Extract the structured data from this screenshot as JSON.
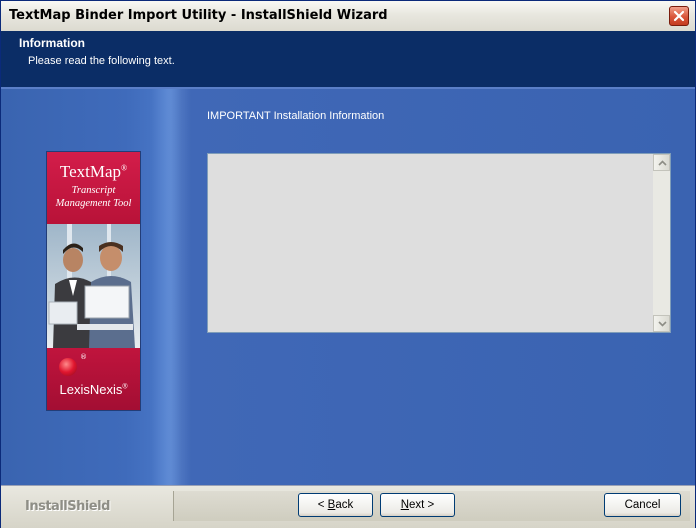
{
  "window": {
    "title": "TextMap Binder Import Utility - InstallShield Wizard"
  },
  "header": {
    "title": "Information",
    "subtitle": "Please read the following text."
  },
  "main": {
    "section_label": "IMPORTANT Installation Information",
    "text_content": ""
  },
  "banner": {
    "brand": "TextMap",
    "brand_mark": "®",
    "tagline_line1": "Transcript",
    "tagline_line2": "Management Tool",
    "company": "LexisNexis",
    "company_mark": "®",
    "logo_mark": "®"
  },
  "footer": {
    "brand": "InstallShield",
    "back_prefix": "< ",
    "back_key": "B",
    "back_rest": "ack",
    "next_key": "N",
    "next_rest": "ext >",
    "cancel_label": "Cancel"
  },
  "colors": {
    "header_bg": "#0b2d66",
    "main_bg": "#3a63b1",
    "banner_red": "#c0143d",
    "close_red": "#d9553a"
  },
  "icons": {
    "close": "close-icon",
    "scroll_up": "chevron-up-icon",
    "scroll_down": "chevron-down-icon"
  }
}
